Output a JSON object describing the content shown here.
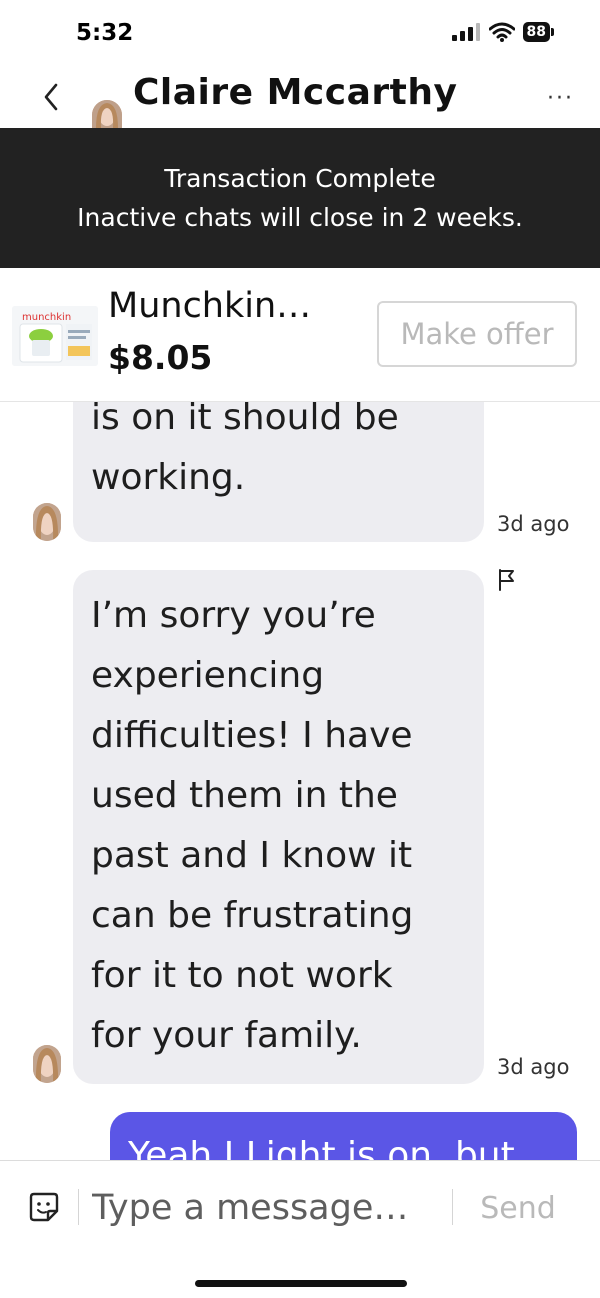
{
  "status_bar": {
    "time": "5:32",
    "battery": "88",
    "icons": [
      "signal-icon",
      "wifi-icon",
      "battery-icon"
    ]
  },
  "header": {
    "contact_name": "Claire Mccarthy",
    "back_icon": "chevron-left-icon",
    "more_icon": "more-horizontal-icon",
    "more_label": "···"
  },
  "banner": {
    "line1": "Transaction Complete",
    "line2": "Inactive chats will close in 2 weeks."
  },
  "listing": {
    "title": "Munchkin…",
    "price": "$8.05",
    "make_offer_label": "Make offer",
    "thumbnail_brand": "munchkin"
  },
  "messages": [
    {
      "direction": "incoming",
      "lines": [
        "is on it should be",
        "working."
      ],
      "time": "3d ago"
    },
    {
      "direction": "incoming",
      "lines": [
        "I’m sorry you’re",
        "experiencing",
        "difficulties! I have",
        "used them in the",
        "past and I know it",
        "can be frustrating",
        "for it to not work",
        "for your family."
      ],
      "time": "3d ago",
      "flag_icon": "flag-icon"
    },
    {
      "direction": "outgoing",
      "lines": [
        "Yeah I Light is on, but"
      ]
    }
  ],
  "composer": {
    "placeholder": "Type a message…",
    "send_label": "Send",
    "sticker_icon": "sticker-icon"
  },
  "colors": {
    "banner_bg": "#222222",
    "incoming_bubble": "#ededf1",
    "outgoing_bubble": "#5b56e6",
    "muted_button": "#b9b9b9"
  }
}
